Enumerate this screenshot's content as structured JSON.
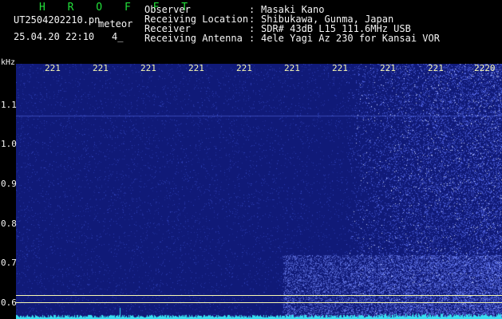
{
  "header": {
    "title": "H R O F F T",
    "filename": "UT2504202210.pn",
    "mode": "meteor",
    "datetime": "25.04.20 22:10",
    "frame": "4_",
    "info": [
      {
        "key": "Observer",
        "value": "Masaki Kano"
      },
      {
        "key": "Receiving Location",
        "value": "Shibukawa, Gunma, Japan"
      },
      {
        "key": "Receiver",
        "value": "SDR# 43dB L15 111.6MHz USB"
      },
      {
        "key": "Receiving Antenna",
        "value": "4ele Yagi Az 230 for Kansai VOR"
      }
    ],
    "separator": ":"
  },
  "spectrogram": {
    "unit_label": "kHz",
    "y_ticks": [
      "1.1",
      "1.0",
      "0.9",
      "0.8",
      "0.7",
      "0.6"
    ],
    "x_ticks": [
      "221",
      "221",
      "221",
      "221",
      "221",
      "221",
      "221",
      "221",
      "221",
      "2220"
    ],
    "colors": {
      "background": "#101a78",
      "noise": "#3a4fd0",
      "strong": "#c8d4ff",
      "trace": "#38e0f0",
      "axis": "#f7f7b0"
    }
  }
}
